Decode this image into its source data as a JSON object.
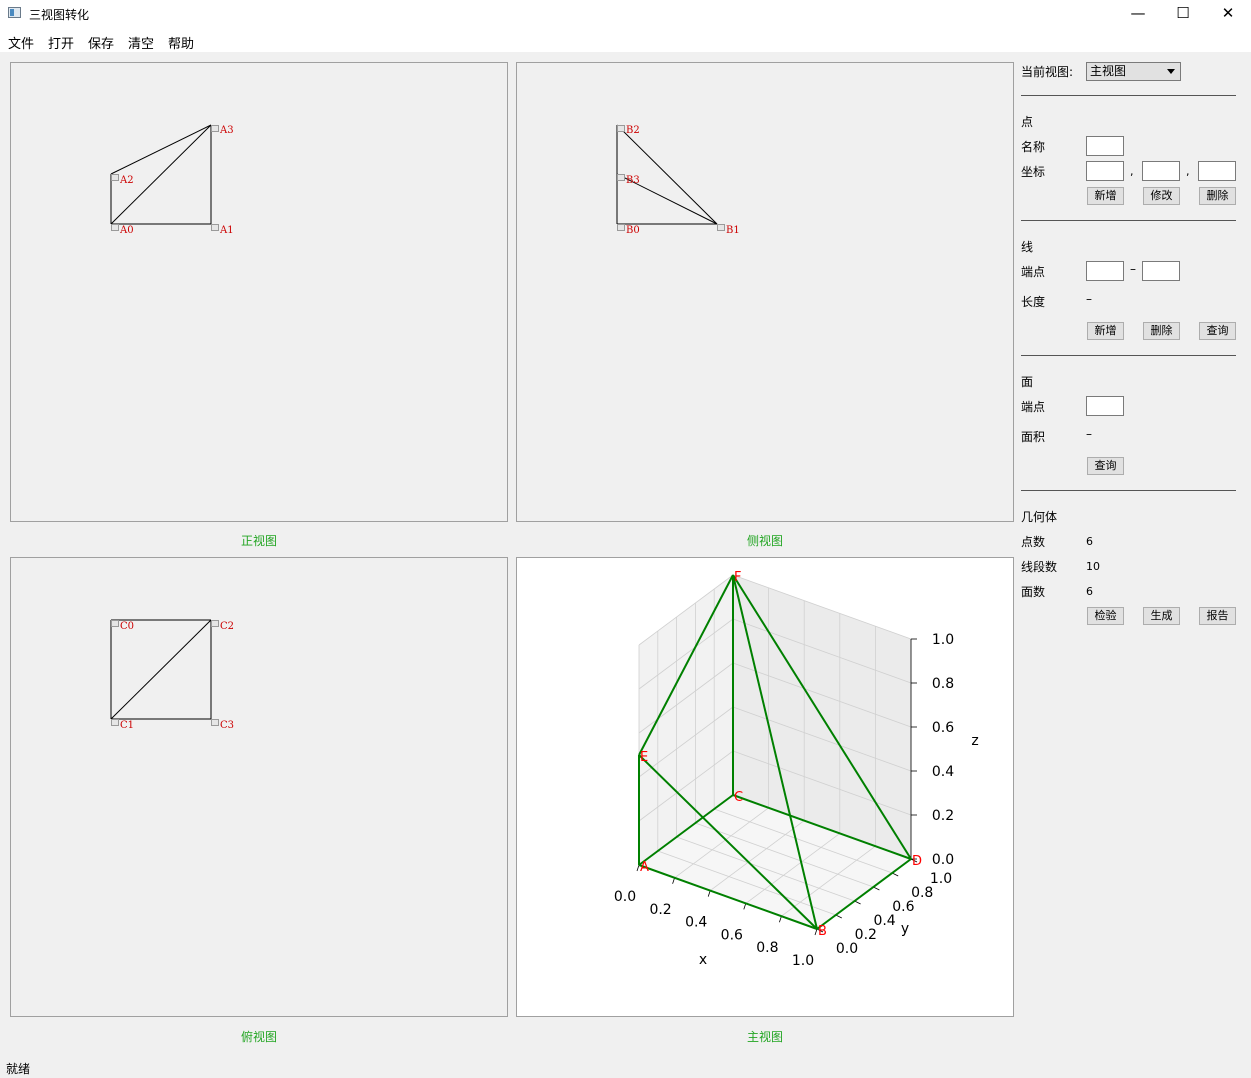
{
  "window": {
    "title": "三视图转化"
  },
  "menu": [
    "文件",
    "打开",
    "保存",
    "清空",
    "帮助"
  ],
  "views": {
    "front": {
      "caption": "正视图",
      "labels": [
        "A0",
        "A1",
        "A2",
        "A3"
      ]
    },
    "side": {
      "caption": "侧视图",
      "labels": [
        "B0",
        "B1",
        "B2",
        "B3"
      ]
    },
    "top": {
      "caption": "俯视图",
      "labels": [
        "C0",
        "C1",
        "C2",
        "C3"
      ]
    },
    "main": {
      "caption": "主视图",
      "chart_data": {
        "type": "line3d",
        "points": [
          {
            "name": "A",
            "x": 0,
            "y": 0,
            "z": 0
          },
          {
            "name": "B",
            "x": 1,
            "y": 0,
            "z": 0
          },
          {
            "name": "C",
            "x": 0,
            "y": 1,
            "z": 0
          },
          {
            "name": "D",
            "x": 1,
            "y": 1,
            "z": 0
          },
          {
            "name": "E",
            "x": 0,
            "y": 0,
            "z": 0.5
          },
          {
            "name": "F",
            "x": 0,
            "y": 1,
            "z": 1
          }
        ],
        "edges": [
          [
            "A",
            "B"
          ],
          [
            "A",
            "C"
          ],
          [
            "B",
            "D"
          ],
          [
            "C",
            "D"
          ],
          [
            "A",
            "E"
          ],
          [
            "E",
            "B"
          ],
          [
            "E",
            "F"
          ],
          [
            "C",
            "F"
          ],
          [
            "B",
            "F"
          ],
          [
            "D",
            "F"
          ]
        ],
        "xlabel": "x",
        "ylabel": "y",
        "zlabel": "z",
        "xlim": [
          0,
          1
        ],
        "ylim": [
          0,
          1
        ],
        "zlim": [
          0,
          1
        ],
        "xticks": [
          "0.0",
          "0.2",
          "0.4",
          "0.6",
          "0.8",
          "1.0"
        ],
        "yticks": [
          "0.0",
          "0.2",
          "0.4",
          "0.6",
          "0.8",
          "1.0"
        ],
        "zticks": [
          "0.0",
          "0.2",
          "0.4",
          "0.6",
          "0.8",
          "1.0"
        ],
        "line_color": "#008000",
        "label_color": "#ff0000",
        "grid": true
      }
    }
  },
  "sidebar": {
    "current_view_label": "当前视图:",
    "current_view_value": "主视图",
    "point": {
      "section": "点",
      "name_label": "名称",
      "coord_label": "坐标",
      "comma": ",",
      "buttons": [
        "新增",
        "修改",
        "删除"
      ]
    },
    "line": {
      "section": "线",
      "endpoint_label": "端点",
      "dash": "–",
      "length_label": "长度",
      "length_value": "–",
      "buttons": [
        "新增",
        "删除",
        "查询"
      ]
    },
    "face": {
      "section": "面",
      "endpoint_label": "端点",
      "area_label": "面积",
      "area_value": "–",
      "buttons": [
        "查询"
      ]
    },
    "solid": {
      "section": "几何体",
      "points_label": "点数",
      "points_value": "6",
      "segments_label": "线段数",
      "segments_value": "10",
      "faces_label": "面数",
      "faces_value": "6",
      "buttons": [
        "检验",
        "生成",
        "报告"
      ]
    }
  },
  "status": {
    "text": "就绪"
  },
  "colors": {
    "caption": "#22a522",
    "vertex_label": "#cc0000",
    "line3d": "#008000"
  },
  "icons": {
    "app": "app-window-icon",
    "minimize": "minimize-icon",
    "maximize": "maximize-icon",
    "close": "close-icon"
  }
}
